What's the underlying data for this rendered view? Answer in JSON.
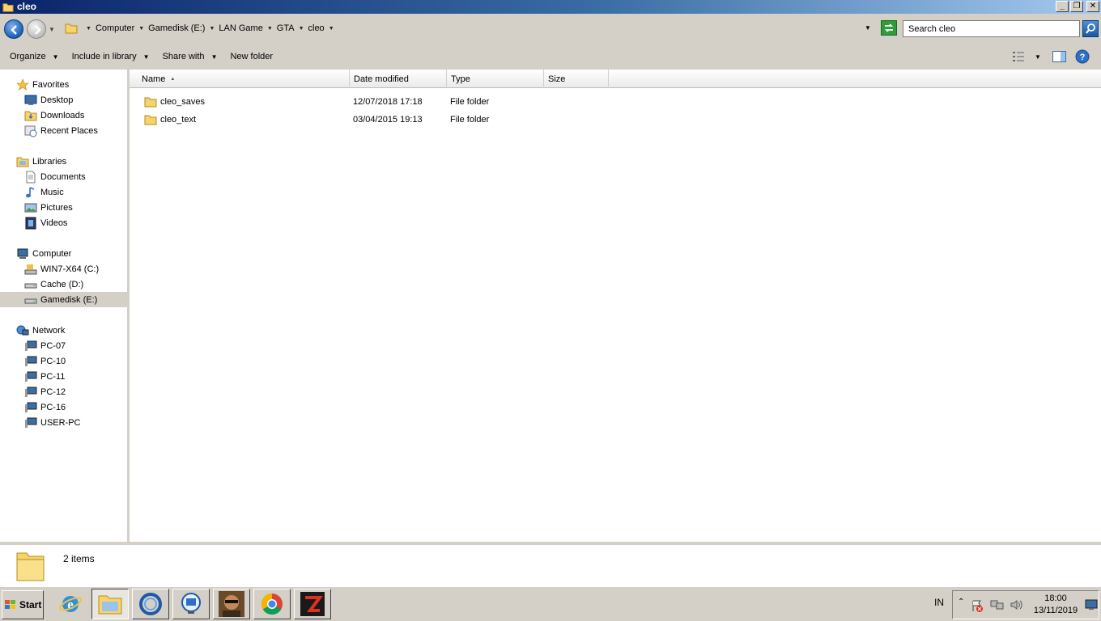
{
  "window": {
    "title": "cleo",
    "controls": [
      "minimize",
      "restore",
      "close"
    ]
  },
  "address": {
    "crumbs": [
      "Computer",
      "Gamedisk (E:)",
      "LAN Game",
      "GTA",
      "cleo"
    ],
    "search_placeholder": "Search cleo"
  },
  "toolbar": {
    "organize": "Organize",
    "include_in_library": "Include in library",
    "share_with": "Share with",
    "new_folder": "New folder"
  },
  "nav": {
    "favorites": {
      "label": "Favorites",
      "items": [
        "Desktop",
        "Downloads",
        "Recent Places"
      ]
    },
    "libraries": {
      "label": "Libraries",
      "items": [
        "Documents",
        "Music",
        "Pictures",
        "Videos"
      ]
    },
    "computer": {
      "label": "Computer",
      "items": [
        "WIN7-X64 (C:)",
        "Cache (D:)",
        "Gamedisk (E:)"
      ],
      "selected": "Gamedisk (E:)"
    },
    "network": {
      "label": "Network",
      "items": [
        "PC-07",
        "PC-10",
        "PC-11",
        "PC-12",
        "PC-16",
        "USER-PC"
      ]
    }
  },
  "columns": [
    "Name",
    "Date modified",
    "Type",
    "Size"
  ],
  "files": [
    {
      "name": "cleo_saves",
      "date": "12/07/2018 17:18",
      "type": "File folder",
      "size": ""
    },
    {
      "name": "cleo_text",
      "date": "03/04/2015 19:13",
      "type": "File folder",
      "size": ""
    }
  ],
  "status": {
    "count": "2 items"
  },
  "taskbar": {
    "start": "Start",
    "apps": [
      "internet-explorer",
      "windows-explorer",
      "ccleaner",
      "remote-viewer",
      "gta-game",
      "chrome",
      "game-launcher"
    ],
    "language": "IN",
    "time": "18:00",
    "date": "13/11/2019"
  },
  "colors": {
    "title_gradient_start": "#0a246a",
    "title_gradient_end": "#a6caf0",
    "chrome": "#d4d0c8",
    "selection": "#d4d0c8"
  }
}
